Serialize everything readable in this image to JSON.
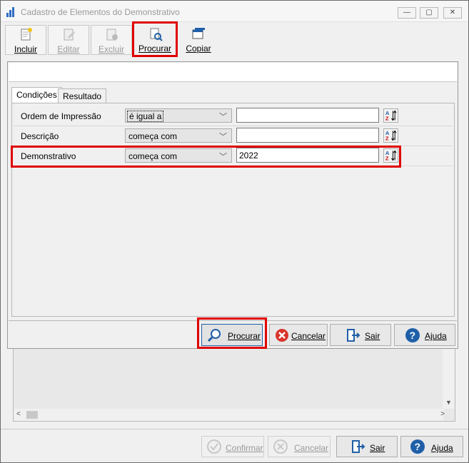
{
  "window": {
    "title": "Cadastro de Elementos do Demonstrativo"
  },
  "toolbar": {
    "incluir": "Incluir",
    "editar": "Editar",
    "excluir": "Excluir",
    "procurar": "Procurar",
    "copiar": "Copiar"
  },
  "tabs": {
    "condicoes": "Condições",
    "resultado": "Resultado"
  },
  "conditions": [
    {
      "label": "Ordem de Impressão",
      "operator": "é igual a",
      "value": ""
    },
    {
      "label": "Descrição",
      "operator": "começa com",
      "value": ""
    },
    {
      "label": "Demonstrativo",
      "operator": "começa com",
      "value": "2022"
    }
  ],
  "dialog_buttons": {
    "procurar": "Procurar",
    "cancelar": "Cancelar",
    "sair": "Sair",
    "ajuda": "Ajuda"
  },
  "bottom_buttons": {
    "confirmar": "Confirmar",
    "cancelar": "Cancelar",
    "sair": "Sair",
    "ajuda": "Ajuda"
  },
  "colors": {
    "highlight": "#e00000",
    "accent": "#1f5fa8"
  }
}
